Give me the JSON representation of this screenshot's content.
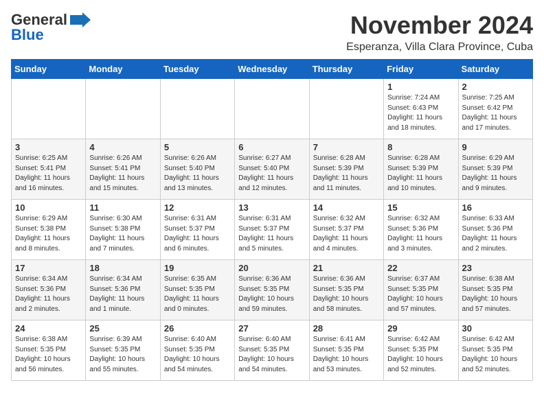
{
  "header": {
    "logo_line1": "General",
    "logo_line2": "Blue",
    "month": "November 2024",
    "location": "Esperanza, Villa Clara Province, Cuba"
  },
  "weekdays": [
    "Sunday",
    "Monday",
    "Tuesday",
    "Wednesday",
    "Thursday",
    "Friday",
    "Saturday"
  ],
  "weeks": [
    [
      {
        "day": "",
        "info": ""
      },
      {
        "day": "",
        "info": ""
      },
      {
        "day": "",
        "info": ""
      },
      {
        "day": "",
        "info": ""
      },
      {
        "day": "",
        "info": ""
      },
      {
        "day": "1",
        "info": "Sunrise: 7:24 AM\nSunset: 6:43 PM\nDaylight: 11 hours\nand 18 minutes."
      },
      {
        "day": "2",
        "info": "Sunrise: 7:25 AM\nSunset: 6:42 PM\nDaylight: 11 hours\nand 17 minutes."
      }
    ],
    [
      {
        "day": "3",
        "info": "Sunrise: 6:25 AM\nSunset: 5:41 PM\nDaylight: 11 hours\nand 16 minutes."
      },
      {
        "day": "4",
        "info": "Sunrise: 6:26 AM\nSunset: 5:41 PM\nDaylight: 11 hours\nand 15 minutes."
      },
      {
        "day": "5",
        "info": "Sunrise: 6:26 AM\nSunset: 5:40 PM\nDaylight: 11 hours\nand 13 minutes."
      },
      {
        "day": "6",
        "info": "Sunrise: 6:27 AM\nSunset: 5:40 PM\nDaylight: 11 hours\nand 12 minutes."
      },
      {
        "day": "7",
        "info": "Sunrise: 6:28 AM\nSunset: 5:39 PM\nDaylight: 11 hours\nand 11 minutes."
      },
      {
        "day": "8",
        "info": "Sunrise: 6:28 AM\nSunset: 5:39 PM\nDaylight: 11 hours\nand 10 minutes."
      },
      {
        "day": "9",
        "info": "Sunrise: 6:29 AM\nSunset: 5:39 PM\nDaylight: 11 hours\nand 9 minutes."
      }
    ],
    [
      {
        "day": "10",
        "info": "Sunrise: 6:29 AM\nSunset: 5:38 PM\nDaylight: 11 hours\nand 8 minutes."
      },
      {
        "day": "11",
        "info": "Sunrise: 6:30 AM\nSunset: 5:38 PM\nDaylight: 11 hours\nand 7 minutes."
      },
      {
        "day": "12",
        "info": "Sunrise: 6:31 AM\nSunset: 5:37 PM\nDaylight: 11 hours\nand 6 minutes."
      },
      {
        "day": "13",
        "info": "Sunrise: 6:31 AM\nSunset: 5:37 PM\nDaylight: 11 hours\nand 5 minutes."
      },
      {
        "day": "14",
        "info": "Sunrise: 6:32 AM\nSunset: 5:37 PM\nDaylight: 11 hours\nand 4 minutes."
      },
      {
        "day": "15",
        "info": "Sunrise: 6:32 AM\nSunset: 5:36 PM\nDaylight: 11 hours\nand 3 minutes."
      },
      {
        "day": "16",
        "info": "Sunrise: 6:33 AM\nSunset: 5:36 PM\nDaylight: 11 hours\nand 2 minutes."
      }
    ],
    [
      {
        "day": "17",
        "info": "Sunrise: 6:34 AM\nSunset: 5:36 PM\nDaylight: 11 hours\nand 2 minutes."
      },
      {
        "day": "18",
        "info": "Sunrise: 6:34 AM\nSunset: 5:36 PM\nDaylight: 11 hours\nand 1 minute."
      },
      {
        "day": "19",
        "info": "Sunrise: 6:35 AM\nSunset: 5:35 PM\nDaylight: 11 hours\nand 0 minutes."
      },
      {
        "day": "20",
        "info": "Sunrise: 6:36 AM\nSunset: 5:35 PM\nDaylight: 10 hours\nand 59 minutes."
      },
      {
        "day": "21",
        "info": "Sunrise: 6:36 AM\nSunset: 5:35 PM\nDaylight: 10 hours\nand 58 minutes."
      },
      {
        "day": "22",
        "info": "Sunrise: 6:37 AM\nSunset: 5:35 PM\nDaylight: 10 hours\nand 57 minutes."
      },
      {
        "day": "23",
        "info": "Sunrise: 6:38 AM\nSunset: 5:35 PM\nDaylight: 10 hours\nand 57 minutes."
      }
    ],
    [
      {
        "day": "24",
        "info": "Sunrise: 6:38 AM\nSunset: 5:35 PM\nDaylight: 10 hours\nand 56 minutes."
      },
      {
        "day": "25",
        "info": "Sunrise: 6:39 AM\nSunset: 5:35 PM\nDaylight: 10 hours\nand 55 minutes."
      },
      {
        "day": "26",
        "info": "Sunrise: 6:40 AM\nSunset: 5:35 PM\nDaylight: 10 hours\nand 54 minutes."
      },
      {
        "day": "27",
        "info": "Sunrise: 6:40 AM\nSunset: 5:35 PM\nDaylight: 10 hours\nand 54 minutes."
      },
      {
        "day": "28",
        "info": "Sunrise: 6:41 AM\nSunset: 5:35 PM\nDaylight: 10 hours\nand 53 minutes."
      },
      {
        "day": "29",
        "info": "Sunrise: 6:42 AM\nSunset: 5:35 PM\nDaylight: 10 hours\nand 52 minutes."
      },
      {
        "day": "30",
        "info": "Sunrise: 6:42 AM\nSunset: 5:35 PM\nDaylight: 10 hours\nand 52 minutes."
      }
    ]
  ]
}
